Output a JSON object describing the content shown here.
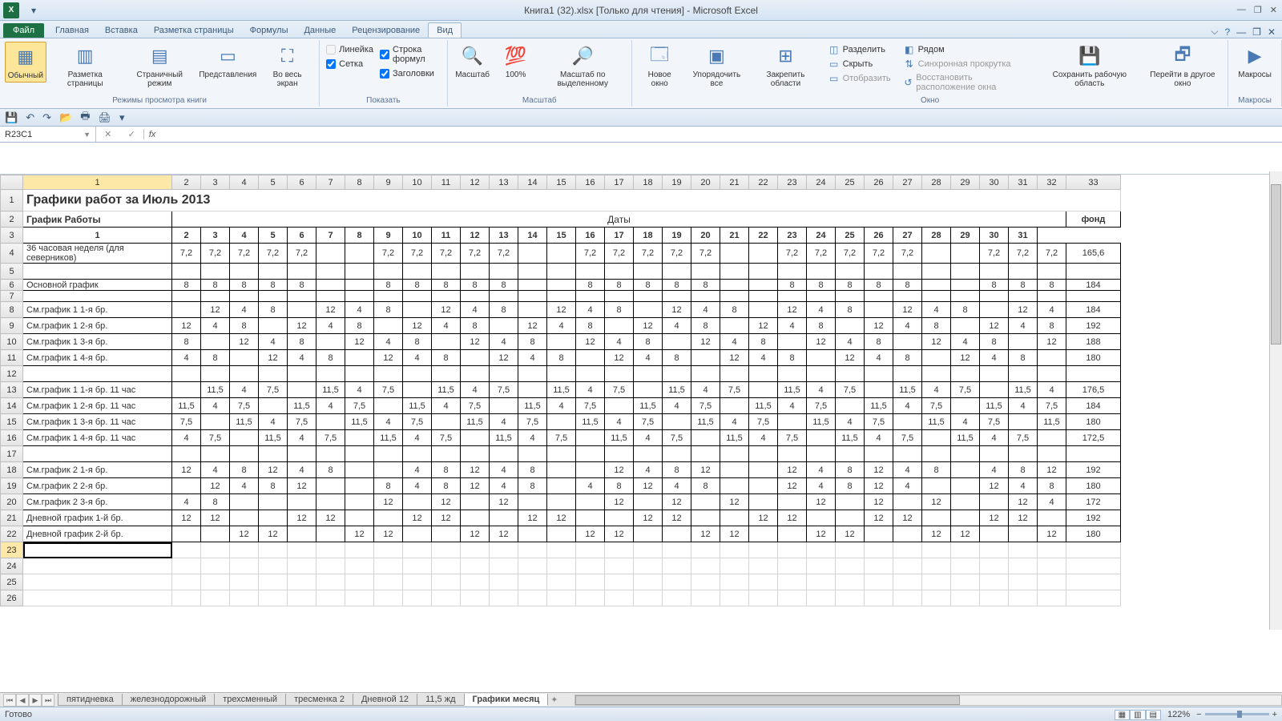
{
  "title": "Книга1 (32).xlsx  [Только для чтения] - Microsoft Excel",
  "namebox": "R23C1",
  "ribbon_tabs": {
    "file": "Файл",
    "home": "Главная",
    "insert": "Вставка",
    "layout": "Разметка страницы",
    "formulas": "Формулы",
    "data": "Данные",
    "review": "Рецензирование",
    "view": "Вид"
  },
  "ribbon": {
    "views": {
      "normal": "Обычный",
      "page_layout": "Разметка страницы",
      "page_break": "Страничный режим",
      "custom": "Представления",
      "full": "Во весь экран",
      "group": "Режимы просмотра книги"
    },
    "show": {
      "ruler": "Линейка",
      "formula_bar": "Строка формул",
      "gridlines": "Сетка",
      "headings": "Заголовки",
      "group": "Показать"
    },
    "zoom": {
      "zoom": "Масштаб",
      "z100": "100%",
      "zsel": "Масштаб по выделенному",
      "group": "Масштаб"
    },
    "window": {
      "neww": "Новое окно",
      "arrange": "Упорядочить все",
      "freeze": "Закрепить области",
      "split": "Разделить",
      "hide": "Скрыть",
      "unhide": "Отобразить",
      "side": "Рядом",
      "sync": "Синхронная прокрутка",
      "reset": "Восстановить расположение окна",
      "save_ws": "Сохранить рабочую область",
      "switch": "Перейти в другое окно",
      "group": "Окно"
    },
    "macros": {
      "macros": "Макросы",
      "group": "Макросы"
    }
  },
  "sheet_tabs": [
    "пятидневка",
    "железнодорожный",
    "трехсменный",
    "тресменка 2",
    "Дневной 12",
    "11,5 жд",
    "Графики месяц"
  ],
  "active_sheet": 6,
  "status": {
    "ready": "Готово",
    "zoom": "122%"
  },
  "col_headers": [
    "1",
    "2",
    "3",
    "4",
    "5",
    "6",
    "7",
    "8",
    "9",
    "10",
    "11",
    "12",
    "13",
    "14",
    "15",
    "16",
    "17",
    "18",
    "19",
    "20",
    "21",
    "22",
    "23",
    "24",
    "25",
    "26",
    "27",
    "28",
    "29",
    "30",
    "31",
    "32",
    "33"
  ],
  "data": {
    "title": "Графики работ за Июль 2013",
    "dates_label": "Даты",
    "schedule_label": "График Работы",
    "fund_label": "фонд",
    "days": [
      "1",
      "2",
      "3",
      "4",
      "5",
      "6",
      "7",
      "8",
      "9",
      "10",
      "11",
      "12",
      "13",
      "14",
      "15",
      "16",
      "17",
      "18",
      "19",
      "20",
      "21",
      "22",
      "23",
      "24",
      "25",
      "26",
      "27",
      "28",
      "29",
      "30",
      "31"
    ],
    "rows": [
      {
        "label": "36 часовая неделя (для северников)",
        "vals": [
          "7,2",
          "7,2",
          "7,2",
          "7,2",
          "7,2",
          "",
          "",
          "7,2",
          "7,2",
          "7,2",
          "7,2",
          "7,2",
          "",
          "",
          "7,2",
          "7,2",
          "7,2",
          "7,2",
          "7,2",
          "",
          "",
          "7,2",
          "7,2",
          "7,2",
          "7,2",
          "7,2",
          "",
          "",
          "7,2",
          "7,2",
          "7,2"
        ],
        "fund": "165,6"
      },
      {
        "label": "",
        "vals": [
          "",
          "",
          "",
          "",
          "",
          "",
          "",
          "",
          "",
          "",
          "",
          "",
          "",
          "",
          "",
          "",
          "",
          "",
          "",
          "",
          "",
          "",
          "",
          "",
          "",
          "",
          "",
          "",
          "",
          "",
          ""
        ],
        "fund": ""
      },
      {
        "label": "Основной график",
        "vals": [
          "8",
          "8",
          "8",
          "8",
          "8",
          "",
          "",
          "8",
          "8",
          "8",
          "8",
          "8",
          "",
          "",
          "8",
          "8",
          "8",
          "8",
          "8",
          "",
          "",
          "8",
          "8",
          "8",
          "8",
          "8",
          "",
          "",
          "8",
          "8",
          "8"
        ],
        "fund": "184",
        "mini": true
      },
      {
        "label": "См.график 1   1-я бр.",
        "vals": [
          "",
          "12",
          "4",
          "8",
          "",
          "12",
          "4",
          "8",
          "",
          "12",
          "4",
          "8",
          "",
          "12",
          "4",
          "8",
          "",
          "12",
          "4",
          "8",
          "",
          "12",
          "4",
          "8",
          "",
          "12",
          "4",
          "8",
          "",
          "12",
          "4"
        ],
        "fund": "184"
      },
      {
        "label": "См.график 1   2-я бр.",
        "vals": [
          "12",
          "4",
          "8",
          "",
          "12",
          "4",
          "8",
          "",
          "12",
          "4",
          "8",
          "",
          "12",
          "4",
          "8",
          "",
          "12",
          "4",
          "8",
          "",
          "12",
          "4",
          "8",
          "",
          "12",
          "4",
          "8",
          "",
          "12",
          "4",
          "8"
        ],
        "fund": "192"
      },
      {
        "label": "См.график 1   3-я бр.",
        "vals": [
          "8",
          "",
          "12",
          "4",
          "8",
          "",
          "12",
          "4",
          "8",
          "",
          "12",
          "4",
          "8",
          "",
          "12",
          "4",
          "8",
          "",
          "12",
          "4",
          "8",
          "",
          "12",
          "4",
          "8",
          "",
          "12",
          "4",
          "8",
          "",
          "12"
        ],
        "fund": "188"
      },
      {
        "label": "См.график 1   4-я бр.",
        "vals": [
          "4",
          "8",
          "",
          "12",
          "4",
          "8",
          "",
          "12",
          "4",
          "8",
          "",
          "12",
          "4",
          "8",
          "",
          "12",
          "4",
          "8",
          "",
          "12",
          "4",
          "8",
          "",
          "12",
          "4",
          "8",
          "",
          "12",
          "4",
          "8",
          ""
        ],
        "fund": "180"
      },
      {
        "label": "",
        "vals": [
          "",
          "",
          "",
          "",
          "",
          "",
          "",
          "",
          "",
          "",
          "",
          "",
          "",
          "",
          "",
          "",
          "",
          "",
          "",
          "",
          "",
          "",
          "",
          "",
          "",
          "",
          "",
          "",
          "",
          "",
          ""
        ],
        "fund": ""
      },
      {
        "label": "См.график 1   1-я бр. 11 час",
        "vals": [
          "",
          "11,5",
          "4",
          "7,5",
          "",
          "11,5",
          "4",
          "7,5",
          "",
          "11,5",
          "4",
          "7,5",
          "",
          "11,5",
          "4",
          "7,5",
          "",
          "11,5",
          "4",
          "7,5",
          "",
          "11,5",
          "4",
          "7,5",
          "",
          "11,5",
          "4",
          "7,5",
          "",
          "11,5",
          "4"
        ],
        "fund": "176,5"
      },
      {
        "label": "См.график 1   2-я бр. 11 час",
        "vals": [
          "11,5",
          "4",
          "7,5",
          "",
          "11,5",
          "4",
          "7,5",
          "",
          "11,5",
          "4",
          "7,5",
          "",
          "11,5",
          "4",
          "7,5",
          "",
          "11,5",
          "4",
          "7,5",
          "",
          "11,5",
          "4",
          "7,5",
          "",
          "11,5",
          "4",
          "7,5",
          "",
          "11,5",
          "4",
          "7,5"
        ],
        "fund": "184"
      },
      {
        "label": "См.график 1   3-я бр. 11 час",
        "vals": [
          "7,5",
          "",
          "11,5",
          "4",
          "7,5",
          "",
          "11,5",
          "4",
          "7,5",
          "",
          "11,5",
          "4",
          "7,5",
          "",
          "11,5",
          "4",
          "7,5",
          "",
          "11,5",
          "4",
          "7,5",
          "",
          "11,5",
          "4",
          "7,5",
          "",
          "11,5",
          "4",
          "7,5",
          "",
          "11,5"
        ],
        "fund": "180"
      },
      {
        "label": "См.график 1   4-я бр. 11 час",
        "vals": [
          "4",
          "7,5",
          "",
          "11,5",
          "4",
          "7,5",
          "",
          "11,5",
          "4",
          "7,5",
          "",
          "11,5",
          "4",
          "7,5",
          "",
          "11,5",
          "4",
          "7,5",
          "",
          "11,5",
          "4",
          "7,5",
          "",
          "11,5",
          "4",
          "7,5",
          "",
          "11,5",
          "4",
          "7,5",
          ""
        ],
        "fund": "172,5"
      },
      {
        "label": "",
        "vals": [
          "",
          "",
          "",
          "",
          "",
          "",
          "",
          "",
          "",
          "",
          "",
          "",
          "",
          "",
          "",
          "",
          "",
          "",
          "",
          "",
          "",
          "",
          "",
          "",
          "",
          "",
          "",
          "",
          "",
          "",
          ""
        ],
        "fund": ""
      },
      {
        "label": "См.график 2   1-я бр.",
        "vals": [
          "12",
          "4",
          "8",
          "12",
          "4",
          "8",
          "",
          "",
          "4",
          "8",
          "12",
          "4",
          "8",
          "",
          "",
          "12",
          "4",
          "8",
          "12",
          "",
          "",
          "12",
          "4",
          "8",
          "12",
          "4",
          "8",
          "",
          "4",
          "8",
          "12"
        ],
        "fund": "192"
      },
      {
        "label": "См.график 2   2-я бр.",
        "vals": [
          "",
          "12",
          "4",
          "8",
          "12",
          "",
          "",
          "8",
          "4",
          "8",
          "12",
          "4",
          "8",
          "",
          "4",
          "8",
          "12",
          "4",
          "8",
          "",
          "",
          "12",
          "4",
          "8",
          "12",
          "4",
          "",
          "",
          "12",
          "4",
          "8"
        ],
        "fund": "180"
      },
      {
        "label": "См.график 2   3-я бр.",
        "vals": [
          "4",
          "8",
          "",
          "",
          "",
          "",
          "",
          "12",
          "",
          "12",
          "",
          "12",
          "",
          "",
          "",
          "12",
          "",
          "12",
          "",
          "12",
          "",
          "",
          "12",
          "",
          "12",
          "",
          "12",
          "",
          "",
          "12",
          "4"
        ],
        "fund": "172"
      },
      {
        "label": "Дневной график 1-й бр.",
        "vals": [
          "12",
          "12",
          "",
          "",
          "12",
          "12",
          "",
          "",
          "12",
          "12",
          "",
          "",
          "12",
          "12",
          "",
          "",
          "12",
          "12",
          "",
          "",
          "12",
          "12",
          "",
          "",
          "12",
          "12",
          "",
          "",
          "12",
          "12",
          ""
        ],
        "fund": "192"
      },
      {
        "label": "Дневной график 2-й бр.",
        "vals": [
          "",
          "",
          "12",
          "12",
          "",
          "",
          "12",
          "12",
          "",
          "",
          "12",
          "12",
          "",
          "",
          "12",
          "12",
          "",
          "",
          "12",
          "12",
          "",
          "",
          "12",
          "12",
          "",
          "",
          "12",
          "12",
          "",
          "",
          "12"
        ],
        "fund": "180"
      }
    ]
  }
}
